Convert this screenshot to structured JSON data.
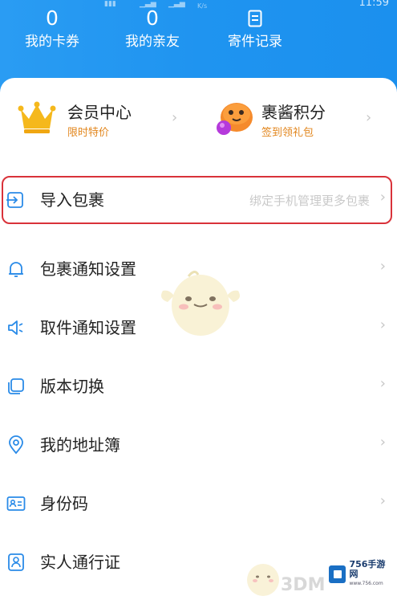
{
  "status_bar": {
    "time": "11:59",
    "speed_unit": "K/s"
  },
  "header": {
    "stats": [
      {
        "value": "0",
        "label": "我的卡券"
      },
      {
        "value": "0",
        "label": "我的亲友"
      },
      {
        "label": "寄件记录",
        "icon": "document-icon"
      }
    ],
    "background_color": "#1f94f0"
  },
  "promos": [
    {
      "title": "会员中心",
      "subtitle": "限时特价",
      "icon": "crown-icon"
    },
    {
      "title": "裹酱积分",
      "subtitle": "签到领礼包",
      "icon": "mascot-ball-icon"
    }
  ],
  "menu": [
    {
      "label": "导入包裹",
      "hint": "绑定手机管理更多包裹",
      "icon": "import-icon",
      "highlighted": true
    },
    {
      "label": "包裹通知设置",
      "icon": "bell-icon"
    },
    {
      "label": "取件通知设置",
      "icon": "speaker-icon"
    },
    {
      "label": "版本切换",
      "icon": "switch-icon"
    },
    {
      "label": "我的地址簿",
      "icon": "location-pin-icon"
    },
    {
      "label": "身份码",
      "icon": "id-card-icon"
    },
    {
      "label": "实人通行证",
      "icon": "user-badge-icon"
    }
  ],
  "watermarks": {
    "left_text": "3DM",
    "badge_title": "756手游网",
    "badge_url": "www.756.com"
  },
  "colors": {
    "accent": "#1f94f0",
    "promo_subtitle": "#e2861d",
    "highlight_border": "#d9323a",
    "icon_blue": "#2a8be8"
  }
}
